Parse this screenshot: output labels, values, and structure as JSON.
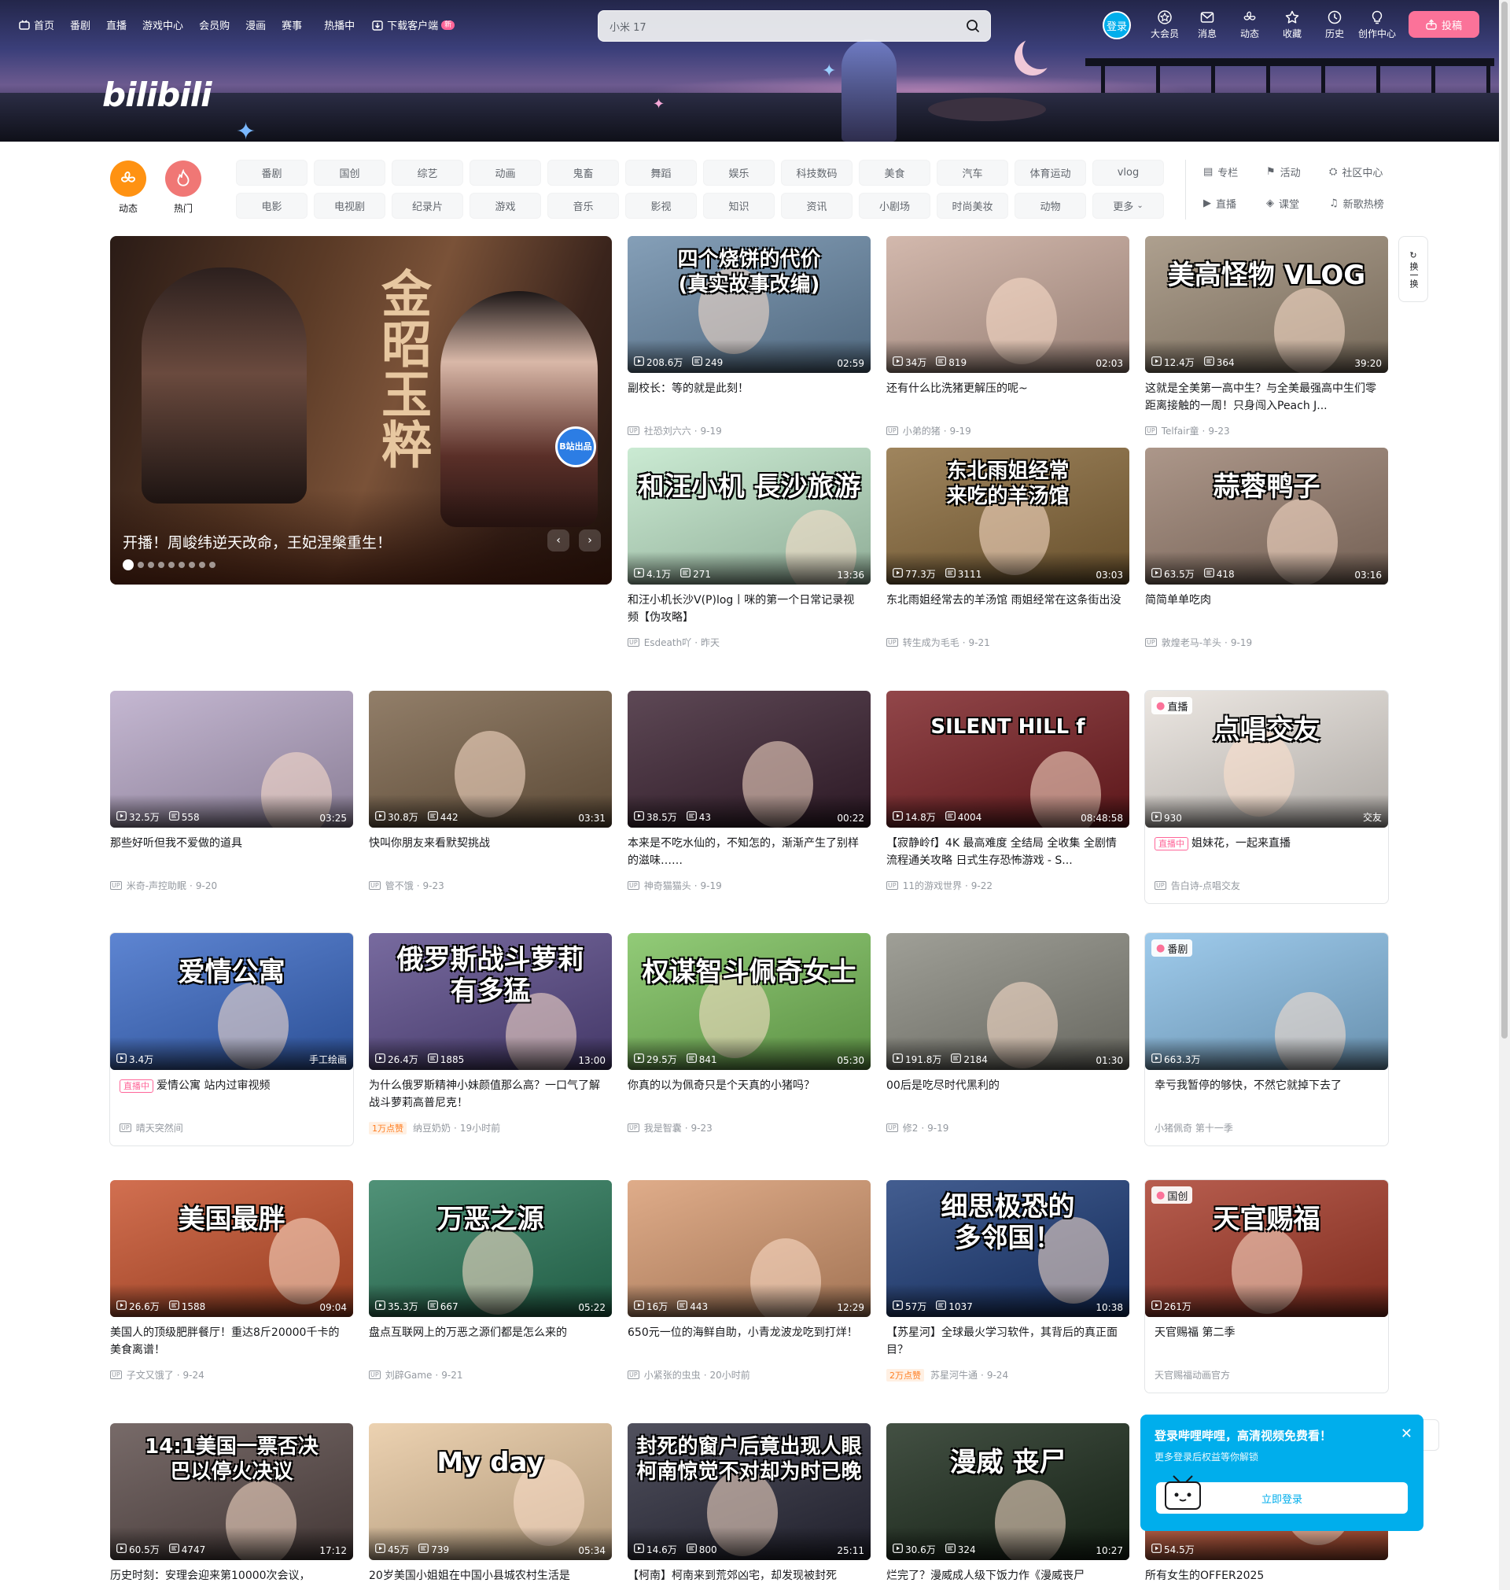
{
  "header": {
    "nav": [
      {
        "label": "首页",
        "icon": "tv-icon"
      },
      {
        "label": "番剧"
      },
      {
        "label": "直播"
      },
      {
        "label": "游戏中心"
      },
      {
        "label": "会员购"
      },
      {
        "label": "漫画"
      },
      {
        "label": "赛事"
      },
      {
        "label": "热播中"
      },
      {
        "label": "下载客户端",
        "icon": "download-icon",
        "badge": "新"
      }
    ],
    "search": {
      "value": "小米 17",
      "placeholder": "小米 17"
    },
    "login": "登录",
    "right": [
      {
        "label": "大会员",
        "icon": "vip-icon"
      },
      {
        "label": "消息",
        "icon": "mail-icon"
      },
      {
        "label": "动态",
        "icon": "wind-icon"
      },
      {
        "label": "收藏",
        "icon": "star-icon"
      },
      {
        "label": "历史",
        "icon": "clock-icon"
      },
      {
        "label": "创作中心",
        "icon": "bulb-icon"
      }
    ],
    "upload": "投稿",
    "logo": "bilibili"
  },
  "channels": {
    "main": [
      {
        "label": "动态",
        "color": "#ff9212"
      },
      {
        "label": "热门",
        "color": "#f07775"
      }
    ],
    "tags": [
      "番剧",
      "国创",
      "综艺",
      "动画",
      "鬼畜",
      "舞蹈",
      "娱乐",
      "科技数码",
      "美食",
      "汽车",
      "体育运动",
      "vlog",
      "电影",
      "电视剧",
      "纪录片",
      "游戏",
      "音乐",
      "影视",
      "知识",
      "资讯",
      "小剧场",
      "时尚美妆",
      "动物",
      "更多"
    ],
    "links": [
      {
        "label": "专栏",
        "icon": "column-icon"
      },
      {
        "label": "活动",
        "icon": "flag-icon"
      },
      {
        "label": "社区中心",
        "icon": "community-icon"
      },
      {
        "label": "直播",
        "icon": "live-icon"
      },
      {
        "label": "课堂",
        "icon": "class-icon"
      },
      {
        "label": "新歌热榜",
        "icon": "music-icon"
      }
    ]
  },
  "banner": {
    "title": "开播！周峻纬逆天改命，王妃涅槃重生！",
    "calligraphy": "金昭玉粹",
    "badge": "B站出品",
    "dots": 9,
    "active_dot": 0
  },
  "refresh": {
    "label": "换一换"
  },
  "cards": [
    {
      "thumb_text": "四个烧饼的代价\n(真实故事改编)",
      "views": "208.6万",
      "danmaku": "249",
      "duration": "02:59",
      "title": "副校长：等的就是此刻！",
      "author": "社恐刘六六",
      "date": "9-19",
      "bg": "#6a8aa8"
    },
    {
      "thumb_text": "",
      "views": "34万",
      "danmaku": "819",
      "duration": "02:03",
      "title": "还有什么比洗猪更解压的呢~",
      "author": "小弟的猪",
      "date": "9-19",
      "bg": "#c9a99b"
    },
    {
      "thumb_text": "美高怪物 VLOG",
      "views": "12.4万",
      "danmaku": "364",
      "duration": "39:20",
      "title": "这就是全美第一高中生？与全美最强高中生们零距离接触的一周！只身闯入Peach J...",
      "author": "Telfair童",
      "date": "9-23",
      "bg": "#9c8b76"
    },
    {
      "thumb_text": "和汪小机 長沙旅游",
      "views": "4.1万",
      "danmaku": "271",
      "duration": "13:36",
      "title": "和汪小机长沙V(P)log丨咪的第一个日常记录视频【伪攻略】",
      "author": "Esdeath吖",
      "date": "昨天",
      "bg": "#bfe6c9"
    },
    {
      "thumb_text": "东北雨姐经常\n来吃的羊汤馆",
      "views": "77.3万",
      "danmaku": "3111",
      "duration": "03:03",
      "title": "东北雨姐经常去的羊汤馆 雨姐经常在这条街出没",
      "author": "转生成为毛毛",
      "date": "9-21",
      "bg": "#8a6a3a"
    },
    {
      "thumb_text": "蒜蓉鸭子",
      "views": "63.5万",
      "danmaku": "418",
      "duration": "03:16",
      "title": "简简单单吃肉",
      "author": "敦煌老马-羊头",
      "date": "9-19",
      "bg": "#9a8070"
    },
    {
      "thumb_text": "",
      "views": "32.5万",
      "danmaku": "558",
      "duration": "03:25",
      "title": "那些好听但我不爱做的道具",
      "author": "米奇-声控助眠",
      "date": "9-20",
      "bg": "#b8a8c8"
    },
    {
      "thumb_text": "",
      "views": "30.8万",
      "danmaku": "442",
      "duration": "03:31",
      "title": "快叫你朋友来看默契挑战",
      "author": "管不饿",
      "date": "9-23",
      "bg": "#7a6248"
    },
    {
      "thumb_text": "",
      "views": "38.5万",
      "danmaku": "43",
      "duration": "00:22",
      "title": "本来是不吃水仙的，不知怎的，渐渐产生了别样的滋味……",
      "author": "神奇猫猫头",
      "date": "9-19",
      "bg": "#3a2030"
    },
    {
      "thumb_text": "SILENT HILL f",
      "views": "14.8万",
      "danmaku": "4004",
      "duration": "08:48:58",
      "title": "【寂静岭f】4K 最高难度 全结局 全收集 全剧情流程通关攻略 日式生存恐怖游戏 - S...",
      "author": "11的游戏世界",
      "date": "9-22",
      "bg": "#7a1e22"
    },
    {
      "thumb_text": "点唱交友",
      "corner": "直播",
      "views": "930",
      "danmaku": "",
      "duration": "交友",
      "title": "姐妹花，一起来直播",
      "live": "直播中",
      "author": "告白诗-点唱交友",
      "date": "",
      "bg": "#e8e2dc"
    },
    {
      "thumb_text": "爱情公寓",
      "views": "3.4万",
      "danmaku": "",
      "duration": "手工绘画",
      "title": "爱情公寓 站内过审视频",
      "live": "直播中",
      "author": "晴天突然间",
      "date": "",
      "bg": "#3a6ac8"
    },
    {
      "thumb_text": "俄罗斯战斗萝莉\n有多猛",
      "views": "26.4万",
      "danmaku": "1885",
      "duration": "13:00",
      "title": "为什么俄罗斯精神小妹颜值那么高？一口气了解战斗萝莉高普尼克！",
      "hot": "1万点赞",
      "author": "纳豆奶奶",
      "date": "19小时前",
      "bg": "#5a4a8a"
    },
    {
      "thumb_text": "权谋智斗佩奇女士",
      "views": "29.5万",
      "danmaku": "841",
      "duration": "05:30",
      "title": "你真的以为佩奇只是个天真的小猪吗？",
      "author": "我是智囊",
      "date": "9-23",
      "bg": "#7ac05a"
    },
    {
      "thumb_text": "",
      "views": "191.8万",
      "danmaku": "2184",
      "duration": "01:30",
      "title": "00后是吃尽时代黑利的",
      "author": "修2",
      "date": "9-19",
      "bg": "#8a8a80"
    },
    {
      "thumb_text": "",
      "corner": "番剧",
      "views": "663.3万",
      "danmaku": "",
      "duration": "",
      "title": "幸亏我暂停的够快，不然它就掉下去了",
      "author": "小猪佩奇 第十一季",
      "date": "",
      "bg": "#8ac0e8"
    },
    {
      "thumb_text": "美国最胖",
      "views": "26.6万",
      "danmaku": "1588",
      "duration": "09:04",
      "title": "美国人的顶级肥胖餐厅！重达8斤20000千卡的美食离谱！",
      "author": "子文又饿了",
      "date": "9-24",
      "bg": "#c8502a"
    },
    {
      "thumb_text": "万恶之源",
      "views": "35.3万",
      "danmaku": "667",
      "duration": "05:22",
      "title": "盘点互联网上的万恶之源们都是怎么来的",
      "author": "刘辟Game",
      "date": "9-21",
      "bg": "#2a7a5a"
    },
    {
      "thumb_text": "",
      "views": "16万",
      "danmaku": "443",
      "duration": "12:29",
      "title": "650元一位的海鲜自助，小青龙波龙吃到打烊！",
      "author": "小紧张的虫虫",
      "date": "20小时前",
      "bg": "#d89a70"
    },
    {
      "thumb_text": "细思极恐的\n多邻国！",
      "views": "57万",
      "danmaku": "1037",
      "duration": "10:38",
      "title": "【苏星河】全球最火学习软件，其背后的真正面目？",
      "hot": "2万点赞",
      "author": "苏星河牛通",
      "date": "9-24",
      "bg": "#1a3a78"
    },
    {
      "thumb_text": "天官赐福",
      "corner": "国创",
      "views": "261万",
      "danmaku": "",
      "duration": "",
      "title": "天官赐福 第二季",
      "author": "天官赐福动画官方",
      "date": "",
      "bg": "#a83a28"
    },
    {
      "thumb_text": "14:1美国一票否决\n巴以停火决议",
      "views": "60.5万",
      "danmaku": "4747",
      "duration": "17:12",
      "title": "历史时刻：安理会迎来第10000次会议，",
      "author": "",
      "date": "",
      "bg": "#5a4a48"
    },
    {
      "thumb_text": "My day",
      "views": "45万",
      "danmaku": "739",
      "duration": "05:34",
      "title": "20岁美国小姐姐在中国小县城农村生活是",
      "author": "",
      "date": "",
      "bg": "#e8c8a0"
    },
    {
      "thumb_text": "封死的窗户后竟出现人眼\n柯南惊觉不对却为时已晚",
      "views": "14.6万",
      "danmaku": "800",
      "duration": "25:11",
      "title": "【柯南】柯南来到荒郊凶宅，却发现被封死",
      "author": "",
      "date": "",
      "bg": "#2a2a3a"
    },
    {
      "thumb_text": "漫威 丧尸",
      "views": "30.6万",
      "danmaku": "324",
      "duration": "10:27",
      "title": "烂完了？漫威成人级下饭力作《漫威丧尸",
      "author": "",
      "date": "",
      "bg": "#1a2a1a"
    },
    {
      "thumb_text": "",
      "views": "54.5万",
      "danmaku": "",
      "duration": "",
      "title": "所有女生的OFFER2025",
      "author": "",
      "date": "",
      "bg": "#c85a3a"
    }
  ],
  "popup": {
    "title": "登录哔哩哔哩，高清视频免费看！",
    "subtitle": "更多登录后权益等你解锁",
    "button": "立即登录"
  }
}
